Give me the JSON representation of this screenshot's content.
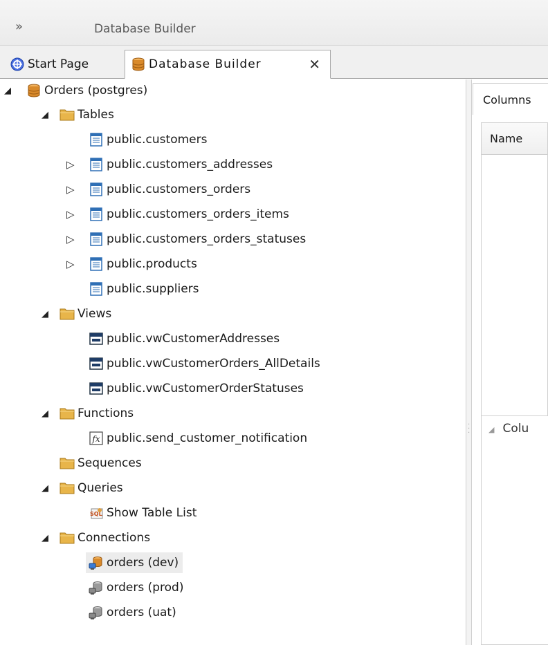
{
  "window": {
    "title": "Database Builder"
  },
  "tabs": {
    "start": {
      "label": "Start Page"
    },
    "active": {
      "label": "Database Builder",
      "close": "✕"
    }
  },
  "tree": {
    "root": "Orders (postgres)",
    "tables": {
      "label": "Tables",
      "items": [
        "public.customers",
        "public.customers_addresses",
        "public.customers_orders",
        "public.customers_orders_items",
        "public.customers_orders_statuses",
        "public.products",
        "public.suppliers"
      ]
    },
    "views": {
      "label": "Views",
      "items": [
        "public.vwCustomerAddresses",
        "public.vwCustomerOrders_AllDetails",
        "public.vwCustomerOrderStatuses"
      ]
    },
    "functions": {
      "label": "Functions",
      "items": [
        "public.send_customer_notification"
      ]
    },
    "sequences": {
      "label": "Sequences"
    },
    "queries": {
      "label": "Queries",
      "items": [
        "Show Table List"
      ]
    },
    "connections": {
      "label": "Connections",
      "items": [
        "orders (dev)",
        "orders (prod)",
        "orders (uat)"
      ]
    }
  },
  "right": {
    "tab": "Columns",
    "grid_header": "Name",
    "lower_header": "Colu"
  },
  "colors": {
    "folder": "#e8b54a",
    "db": "#d98a2b",
    "table_icon": "#2f6fb5",
    "selected_bg": "#ececec"
  }
}
